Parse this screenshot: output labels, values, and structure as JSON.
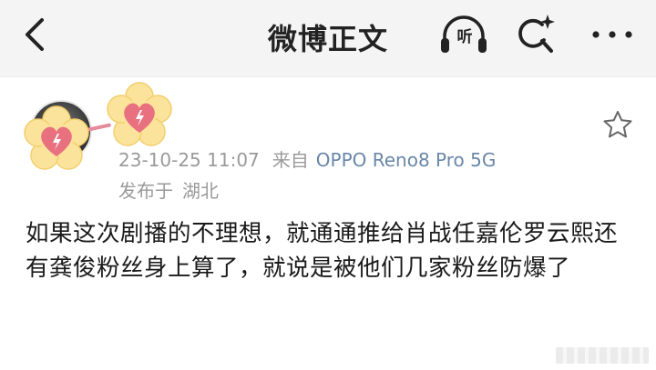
{
  "header": {
    "title": "微博正文",
    "listen_label": "听"
  },
  "post": {
    "timestamp": "23-10-25 11:07",
    "source_prefix": "来自",
    "device": "OPPO Reno8 Pro 5G",
    "location_prefix": "发布于",
    "location": "湖北",
    "body": "如果这次剧播的不理想，就通通推给肖战任嘉伦罗云熙还有龚俊粉丝身上算了，就说是被他们几家粉丝防爆了"
  },
  "colors": {
    "background": "#f2f2f2",
    "card": "#ffffff",
    "meta_text": "#9a9a9a",
    "device_link": "#6a87a8",
    "sticker_heart": "#e8707f",
    "sticker_flower": "#fbe39b"
  },
  "icons": {
    "back": "chevron-left-icon",
    "listen": "headphones-icon",
    "search": "sparkle-search-icon",
    "more": "more-dots-icon",
    "favorite": "star-icon",
    "sticker": "heart-flower-sticker-icon"
  }
}
